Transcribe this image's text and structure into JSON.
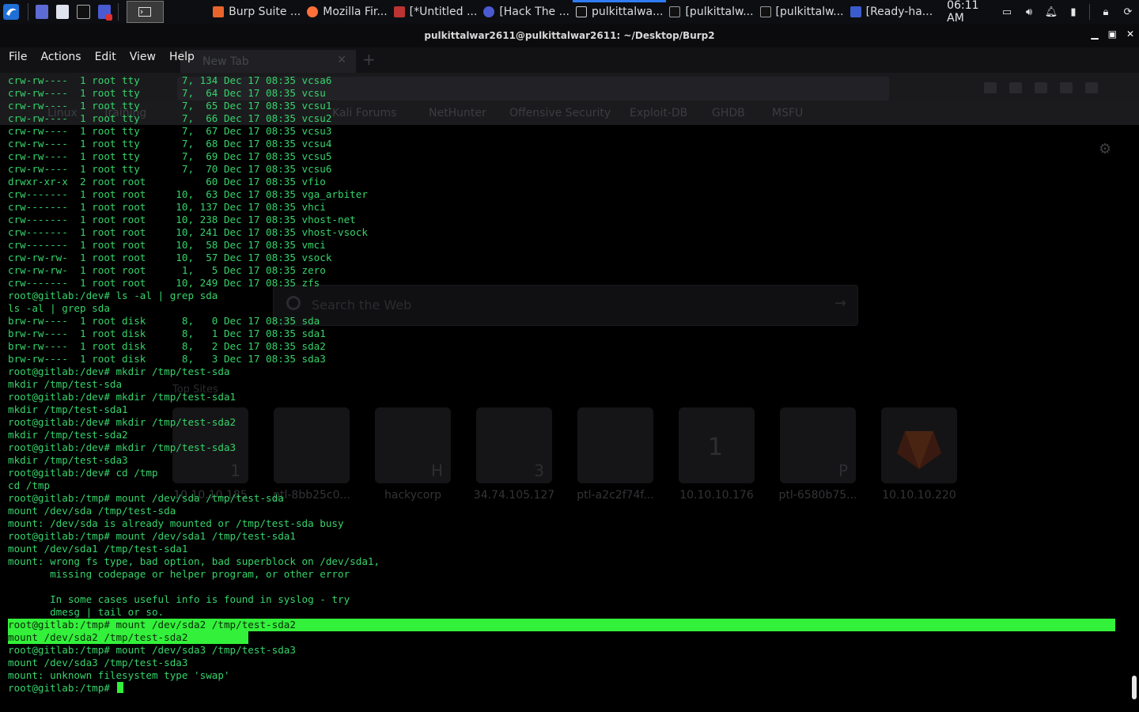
{
  "taskbar": {
    "tasks": [
      {
        "label": "Burp Suite ...",
        "icon": "burp-icon",
        "color": "#e8642c"
      },
      {
        "label": "Mozilla Fir...",
        "icon": "firefox-icon",
        "color": "#ff7139"
      },
      {
        "label": "[*Untitled ...",
        "icon": "editor-icon",
        "color": "#c44"
      },
      {
        "label": "[Hack The ...",
        "icon": "browser-icon",
        "color": "#4a5ad0"
      },
      {
        "label": "pulkittalwa...",
        "icon": "terminal-icon",
        "color": "#ccc"
      },
      {
        "label": "[pulkittalw...",
        "icon": "terminal-icon",
        "color": "#ccc"
      },
      {
        "label": "[pulkittalw...",
        "icon": "terminal-icon",
        "color": "#ccc"
      },
      {
        "label": "[Ready-ha...",
        "icon": "folder-icon",
        "color": "#3a5ccc"
      }
    ],
    "clock": "06:11 AM",
    "accent": "#2f7df6"
  },
  "window": {
    "title": "pulkittalwar2611@pulkittalwar2611: ~/Desktop/Burp2"
  },
  "menu": {
    "items": [
      "File",
      "Actions",
      "Edit",
      "View",
      "Help"
    ]
  },
  "background_browser": {
    "tab_title": "New Tab",
    "bookmarks": [
      "Linux",
      "Training",
      "Kali Forums",
      "NetHunter",
      "Offensive Security",
      "Exploit-DB",
      "GHDB",
      "MSFU"
    ],
    "search_placeholder": "Search the Web",
    "top_sites_label": "Top Sites",
    "tiles": [
      {
        "label": "10.10.10.185",
        "badge": "1"
      },
      {
        "label": "ptl-8bb25c0...",
        "badge": ""
      },
      {
        "label": "hackycorp",
        "badge": "H"
      },
      {
        "label": "34.74.105.127",
        "badge": "3"
      },
      {
        "label": "ptl-a2c2f74f...",
        "badge": ""
      },
      {
        "label": "10.10.10.176",
        "badge": "1"
      },
      {
        "label": "ptl-6580b75...",
        "badge": "P"
      },
      {
        "label": "10.10.10.220",
        "badge": ""
      }
    ]
  },
  "terminal": {
    "colors": {
      "text": "#36d36a",
      "highlight": "#33f03a"
    },
    "lines": [
      "crw-rw----  1 root tty       7, 134 Dec 17 08:35 vcsa6",
      "crw-rw----  1 root tty       7,  64 Dec 17 08:35 vcsu",
      "crw-rw----  1 root tty       7,  65 Dec 17 08:35 vcsu1",
      "crw-rw----  1 root tty       7,  66 Dec 17 08:35 vcsu2",
      "crw-rw----  1 root tty       7,  67 Dec 17 08:35 vcsu3",
      "crw-rw----  1 root tty       7,  68 Dec 17 08:35 vcsu4",
      "crw-rw----  1 root tty       7,  69 Dec 17 08:35 vcsu5",
      "crw-rw----  1 root tty       7,  70 Dec 17 08:35 vcsu6",
      "drwxr-xr-x  2 root root          60 Dec 17 08:35 vfio",
      "crw-------  1 root root     10,  63 Dec 17 08:35 vga_arbiter",
      "crw-------  1 root root     10, 137 Dec 17 08:35 vhci",
      "crw-------  1 root root     10, 238 Dec 17 08:35 vhost-net",
      "crw-------  1 root root     10, 241 Dec 17 08:35 vhost-vsock",
      "crw-------  1 root root     10,  58 Dec 17 08:35 vmci",
      "crw-rw-rw-  1 root root     10,  57 Dec 17 08:35 vsock",
      "crw-rw-rw-  1 root root      1,   5 Dec 17 08:35 zero",
      "crw-------  1 root root     10, 249 Dec 17 08:35 zfs",
      "root@gitlab:/dev# ls -al | grep sda",
      "ls -al | grep sda",
      "brw-rw----  1 root disk      8,   0 Dec 17 08:35 sda",
      "brw-rw----  1 root disk      8,   1 Dec 17 08:35 sda1",
      "brw-rw----  1 root disk      8,   2 Dec 17 08:35 sda2",
      "brw-rw----  1 root disk      8,   3 Dec 17 08:35 sda3",
      "root@gitlab:/dev# mkdir /tmp/test-sda",
      "mkdir /tmp/test-sda",
      "root@gitlab:/dev# mkdir /tmp/test-sda1",
      "mkdir /tmp/test-sda1",
      "root@gitlab:/dev# mkdir /tmp/test-sda2",
      "mkdir /tmp/test-sda2",
      "root@gitlab:/dev# mkdir /tmp/test-sda3",
      "mkdir /tmp/test-sda3",
      "root@gitlab:/dev# cd /tmp",
      "cd /tmp",
      "root@gitlab:/tmp# mount /dev/sda /tmp/test-sda",
      "mount /dev/sda /tmp/test-sda",
      "mount: /dev/sda is already mounted or /tmp/test-sda busy",
      "root@gitlab:/tmp# mount /dev/sda1 /tmp/test-sda1",
      "mount /dev/sda1 /tmp/test-sda1",
      "mount: wrong fs type, bad option, bad superblock on /dev/sda1,",
      "       missing codepage or helper program, or other error",
      "",
      "       In some cases useful info is found in syslog - try",
      "       dmesg | tail or so.",
      "root@gitlab:/tmp# mount /dev/sda2 /tmp/test-sda2",
      "mount /dev/sda2 /tmp/test-sda2",
      "root@gitlab:/tmp# mount /dev/sda3 /tmp/test-sda3",
      "mount /dev/sda3 /tmp/test-sda3",
      "mount: unknown filesystem type 'swap'"
    ],
    "prompt": "root@gitlab:/tmp# "
  }
}
